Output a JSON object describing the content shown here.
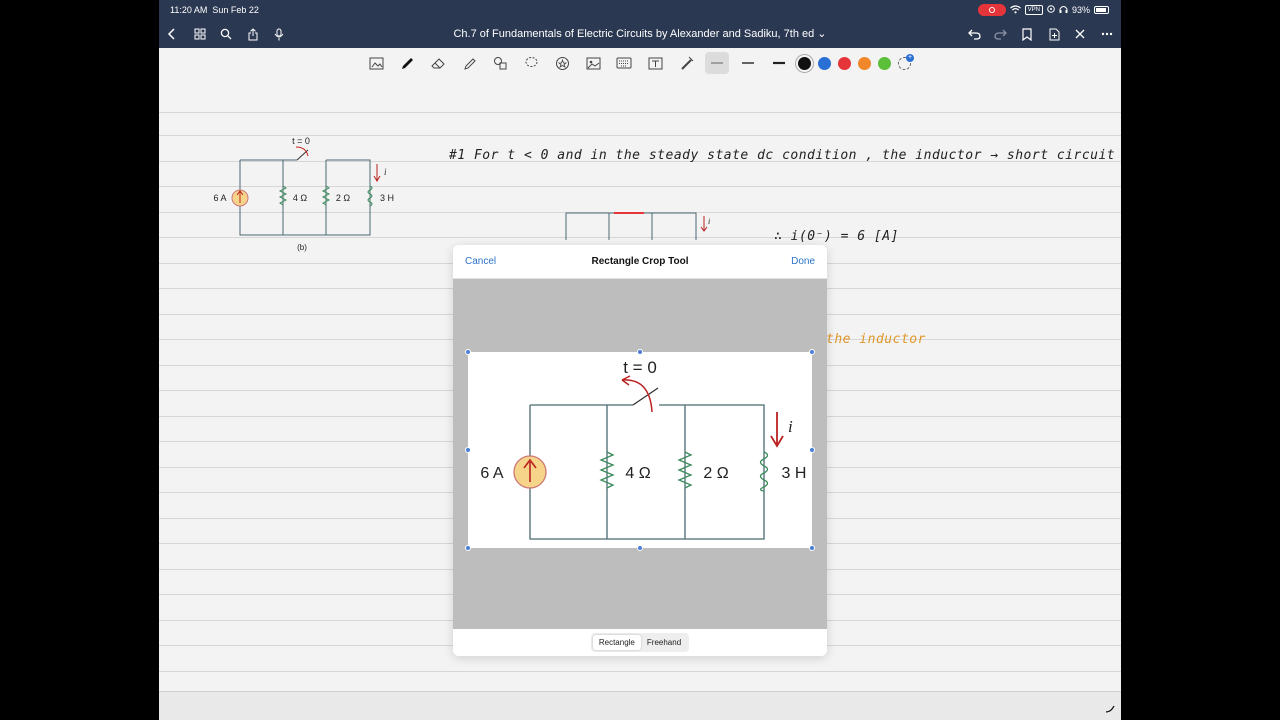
{
  "status_bar": {
    "time": "11:20 AM",
    "date": "Sun Feb 22",
    "vpn": "VPN",
    "battery": "93%"
  },
  "nav": {
    "title": "Ch.7 of Fundamentals of Electric Circuits by Alexander and Sadiku, 7th ed ⌄"
  },
  "toolbar": {
    "pen_colors": [
      "#111111",
      "#2a6fd4",
      "#e5343a",
      "#f0882a",
      "#5bbf3a"
    ]
  },
  "reference_figure": {
    "switch_label": "t = 0",
    "source_label": "6 A",
    "r1_label": "4 Ω",
    "r2_label": "2 Ω",
    "l_label": "3 H",
    "current_label": "i",
    "caption": "(b)"
  },
  "notes": {
    "line1": "#1   For  t < 0   and  in the  steady state  dc  condition ,   the  inductor  →  short circuit",
    "line2": "∴  i(0⁻)  =  6 [A]",
    "line3": "the  inductor"
  },
  "crop_dialog": {
    "cancel_label": "Cancel",
    "title": "Rectangle Crop Tool",
    "done_label": "Done",
    "modes": [
      "Rectangle",
      "Freehand"
    ],
    "selected_mode": "Rectangle",
    "figure": {
      "switch_label": "t = 0",
      "source_label": "6 A",
      "r1_label": "4 Ω",
      "r2_label": "2 Ω",
      "l_label": "3 H",
      "current_label": "i"
    }
  }
}
